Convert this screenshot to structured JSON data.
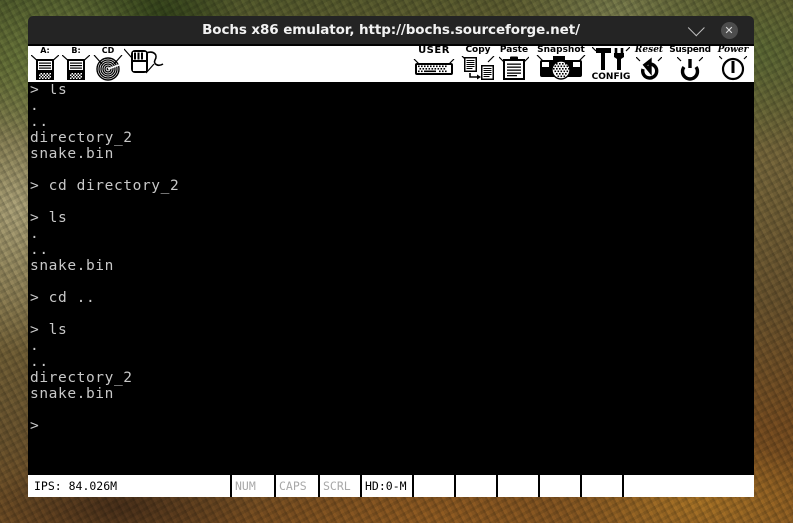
{
  "window": {
    "title": "Bochs x86 emulator, http://bochs.sourceforge.net/",
    "minimize_icon": "chevron-down-icon",
    "close_icon": "close-icon"
  },
  "toolbar": {
    "left_items": [
      {
        "label": "A:",
        "icon": "floppy-a-icon"
      },
      {
        "label": "B:",
        "icon": "floppy-b-icon"
      },
      {
        "label": "CD",
        "icon": "cdrom-icon"
      },
      {
        "label": "",
        "icon": "mouse-icon"
      }
    ],
    "right_items": [
      {
        "label": "USER",
        "icon": "user-keyboard-icon"
      },
      {
        "label": "Copy",
        "icon": "copy-icon"
      },
      {
        "label": "Paste",
        "icon": "paste-icon"
      },
      {
        "label": "Snapshot",
        "icon": "camera-icon"
      },
      {
        "label": "CONFIG",
        "icon": "config-tools-icon"
      },
      {
        "label": "Reset",
        "icon": "reset-icon"
      },
      {
        "label": "Suspend",
        "icon": "suspend-icon"
      },
      {
        "label": "Power",
        "icon": "power-icon"
      }
    ]
  },
  "screen": {
    "lines": [
      "> ls",
      ".",
      "..",
      "directory_2",
      "snake.bin",
      "",
      "> cd directory_2",
      "",
      "> ls",
      ".",
      "..",
      "snake.bin",
      "",
      "> cd ..",
      "",
      "> ls",
      ".",
      "..",
      "directory_2",
      "snake.bin",
      "",
      ">"
    ],
    "text_color": "#c8c8c8",
    "background_color": "#000000"
  },
  "statusbar": {
    "ips": "IPS: 84.026M",
    "indicators": [
      {
        "label": "NUM",
        "active": false
      },
      {
        "label": "CAPS",
        "active": false
      },
      {
        "label": "SCRL",
        "active": false
      },
      {
        "label": "HD:0-M",
        "active": true
      },
      {
        "label": "",
        "active": false
      },
      {
        "label": "",
        "active": false
      },
      {
        "label": "",
        "active": false
      },
      {
        "label": "",
        "active": false
      },
      {
        "label": "",
        "active": false
      },
      {
        "label": "",
        "active": false
      }
    ]
  }
}
